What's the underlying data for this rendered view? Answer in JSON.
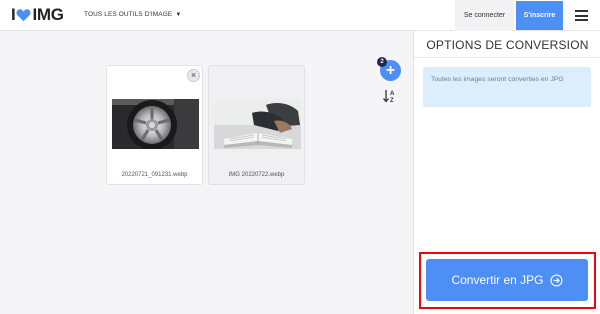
{
  "header": {
    "logo_left": "I",
    "logo_right": "IMG",
    "tools_menu_label": "TOUS LES OUTILS D'IMAGE",
    "login_label": "Se connecter",
    "signup_label": "S'inscrire"
  },
  "workspace": {
    "file_count": "2",
    "files": [
      {
        "name": "20220721_091231.webp",
        "thumb": "wheel-photo"
      },
      {
        "name": "IMG 20220722.webp",
        "thumb": "book-photo"
      }
    ]
  },
  "panel": {
    "title": "OPTIONS DE CONVERSION",
    "info": "Toutes les images seront converties en JPG",
    "convert_label": "Convertir en JPG"
  },
  "colors": {
    "accent": "#4d8ff5",
    "highlight": "#e8090c",
    "info_bg": "#dceefb"
  }
}
